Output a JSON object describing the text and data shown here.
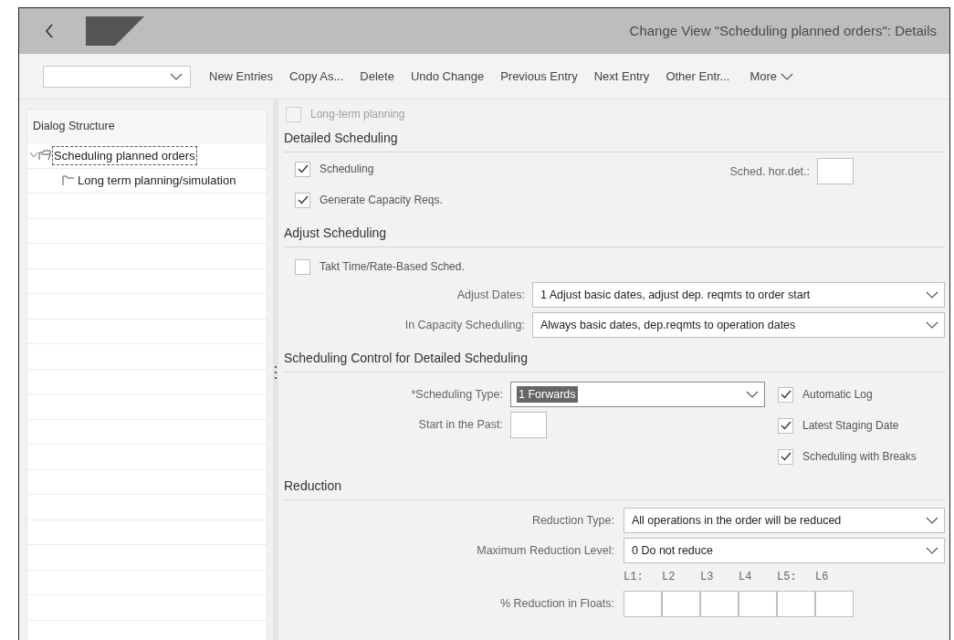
{
  "header": {
    "title": "Change View \"Scheduling planned orders\": Details"
  },
  "toolbar": {
    "actions": [
      "New Entries",
      "Copy As...",
      "Delete",
      "Undo Change",
      "Previous Entry",
      "Next Entry",
      "Other Entr..."
    ],
    "more": "More"
  },
  "dialog_structure": {
    "title": "Dialog Structure",
    "items": [
      {
        "label": "Scheduling planned orders",
        "selected": true,
        "expanded": true,
        "children": [
          {
            "label": "Long term planning/simulation",
            "selected": false
          }
        ]
      }
    ]
  },
  "long_term_planning": {
    "label": "Long-term planning",
    "checked": false,
    "disabled": true
  },
  "detailed_scheduling": {
    "title": "Detailed Scheduling",
    "checks": [
      {
        "label": "Scheduling",
        "checked": true
      },
      {
        "label": "Generate Capacity Reqs.",
        "checked": true
      }
    ],
    "sched_hor_det": {
      "label": "Sched. hor.det.:"
    }
  },
  "adjust_scheduling": {
    "title": "Adjust Scheduling",
    "takt_time": {
      "label": "Takt Time/Rate-Based Sched.",
      "checked": false
    },
    "selects": [
      {
        "label": "Adjust Dates:",
        "value": "1 Adjust basic dates, adjust dep. reqmts to order start"
      },
      {
        "label": "In Capacity Scheduling:",
        "value": "Always basic dates, dep.reqmts to operation dates"
      }
    ]
  },
  "scheduling_control": {
    "title": "Scheduling Control for Detailed Scheduling",
    "scheduling_type": {
      "label": "*Scheduling Type:",
      "value": "1 Forwards",
      "text_selected": true
    },
    "start_in_past": {
      "label": "Start in the Past:"
    },
    "checks": [
      {
        "label": "Automatic Log",
        "checked": true
      },
      {
        "label": "Latest Staging Date",
        "checked": true
      },
      {
        "label": "Scheduling with Breaks",
        "checked": true
      }
    ]
  },
  "reduction": {
    "title": "Reduction",
    "selects": [
      {
        "label": "Reduction Type:",
        "value": "All operations in the order will be reduced"
      },
      {
        "label": "Maximum Reduction Level:",
        "value": "0 Do not reduce"
      }
    ],
    "level_labels": [
      "L1:",
      "L2",
      "L3",
      "L4",
      "L5:",
      "L6"
    ],
    "floats": {
      "label": "% Reduction in Floats:"
    }
  }
}
